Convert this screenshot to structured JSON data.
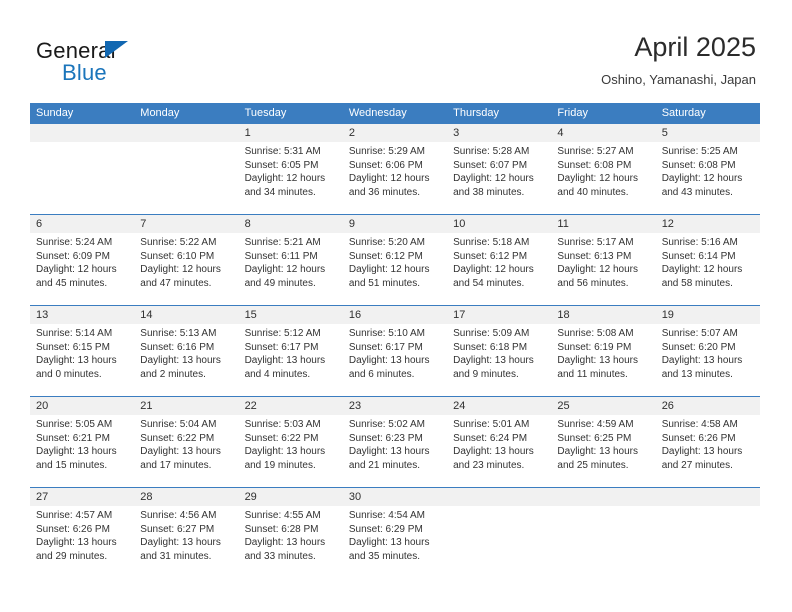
{
  "logo": {
    "word1": "General",
    "word2": "Blue",
    "triangle_color": "#1167b1",
    "blue_color": "#1b75bb"
  },
  "header": {
    "title": "April 2025",
    "subtitle": "Oshino, Yamanashi, Japan",
    "accent_color": "#3b7dc0",
    "band_color": "#f1f1f1"
  },
  "weekdays": [
    "Sunday",
    "Monday",
    "Tuesday",
    "Wednesday",
    "Thursday",
    "Friday",
    "Saturday"
  ],
  "weeks": [
    [
      {
        "day": "",
        "sunrise": "",
        "sunset": "",
        "daylight1": "",
        "daylight2": ""
      },
      {
        "day": "",
        "sunrise": "",
        "sunset": "",
        "daylight1": "",
        "daylight2": ""
      },
      {
        "day": "1",
        "sunrise": "Sunrise: 5:31 AM",
        "sunset": "Sunset: 6:05 PM",
        "daylight1": "Daylight: 12 hours",
        "daylight2": "and 34 minutes."
      },
      {
        "day": "2",
        "sunrise": "Sunrise: 5:29 AM",
        "sunset": "Sunset: 6:06 PM",
        "daylight1": "Daylight: 12 hours",
        "daylight2": "and 36 minutes."
      },
      {
        "day": "3",
        "sunrise": "Sunrise: 5:28 AM",
        "sunset": "Sunset: 6:07 PM",
        "daylight1": "Daylight: 12 hours",
        "daylight2": "and 38 minutes."
      },
      {
        "day": "4",
        "sunrise": "Sunrise: 5:27 AM",
        "sunset": "Sunset: 6:08 PM",
        "daylight1": "Daylight: 12 hours",
        "daylight2": "and 40 minutes."
      },
      {
        "day": "5",
        "sunrise": "Sunrise: 5:25 AM",
        "sunset": "Sunset: 6:08 PM",
        "daylight1": "Daylight: 12 hours",
        "daylight2": "and 43 minutes."
      }
    ],
    [
      {
        "day": "6",
        "sunrise": "Sunrise: 5:24 AM",
        "sunset": "Sunset: 6:09 PM",
        "daylight1": "Daylight: 12 hours",
        "daylight2": "and 45 minutes."
      },
      {
        "day": "7",
        "sunrise": "Sunrise: 5:22 AM",
        "sunset": "Sunset: 6:10 PM",
        "daylight1": "Daylight: 12 hours",
        "daylight2": "and 47 minutes."
      },
      {
        "day": "8",
        "sunrise": "Sunrise: 5:21 AM",
        "sunset": "Sunset: 6:11 PM",
        "daylight1": "Daylight: 12 hours",
        "daylight2": "and 49 minutes."
      },
      {
        "day": "9",
        "sunrise": "Sunrise: 5:20 AM",
        "sunset": "Sunset: 6:12 PM",
        "daylight1": "Daylight: 12 hours",
        "daylight2": "and 51 minutes."
      },
      {
        "day": "10",
        "sunrise": "Sunrise: 5:18 AM",
        "sunset": "Sunset: 6:12 PM",
        "daylight1": "Daylight: 12 hours",
        "daylight2": "and 54 minutes."
      },
      {
        "day": "11",
        "sunrise": "Sunrise: 5:17 AM",
        "sunset": "Sunset: 6:13 PM",
        "daylight1": "Daylight: 12 hours",
        "daylight2": "and 56 minutes."
      },
      {
        "day": "12",
        "sunrise": "Sunrise: 5:16 AM",
        "sunset": "Sunset: 6:14 PM",
        "daylight1": "Daylight: 12 hours",
        "daylight2": "and 58 minutes."
      }
    ],
    [
      {
        "day": "13",
        "sunrise": "Sunrise: 5:14 AM",
        "sunset": "Sunset: 6:15 PM",
        "daylight1": "Daylight: 13 hours",
        "daylight2": "and 0 minutes."
      },
      {
        "day": "14",
        "sunrise": "Sunrise: 5:13 AM",
        "sunset": "Sunset: 6:16 PM",
        "daylight1": "Daylight: 13 hours",
        "daylight2": "and 2 minutes."
      },
      {
        "day": "15",
        "sunrise": "Sunrise: 5:12 AM",
        "sunset": "Sunset: 6:17 PM",
        "daylight1": "Daylight: 13 hours",
        "daylight2": "and 4 minutes."
      },
      {
        "day": "16",
        "sunrise": "Sunrise: 5:10 AM",
        "sunset": "Sunset: 6:17 PM",
        "daylight1": "Daylight: 13 hours",
        "daylight2": "and 6 minutes."
      },
      {
        "day": "17",
        "sunrise": "Sunrise: 5:09 AM",
        "sunset": "Sunset: 6:18 PM",
        "daylight1": "Daylight: 13 hours",
        "daylight2": "and 9 minutes."
      },
      {
        "day": "18",
        "sunrise": "Sunrise: 5:08 AM",
        "sunset": "Sunset: 6:19 PM",
        "daylight1": "Daylight: 13 hours",
        "daylight2": "and 11 minutes."
      },
      {
        "day": "19",
        "sunrise": "Sunrise: 5:07 AM",
        "sunset": "Sunset: 6:20 PM",
        "daylight1": "Daylight: 13 hours",
        "daylight2": "and 13 minutes."
      }
    ],
    [
      {
        "day": "20",
        "sunrise": "Sunrise: 5:05 AM",
        "sunset": "Sunset: 6:21 PM",
        "daylight1": "Daylight: 13 hours",
        "daylight2": "and 15 minutes."
      },
      {
        "day": "21",
        "sunrise": "Sunrise: 5:04 AM",
        "sunset": "Sunset: 6:22 PM",
        "daylight1": "Daylight: 13 hours",
        "daylight2": "and 17 minutes."
      },
      {
        "day": "22",
        "sunrise": "Sunrise: 5:03 AM",
        "sunset": "Sunset: 6:22 PM",
        "daylight1": "Daylight: 13 hours",
        "daylight2": "and 19 minutes."
      },
      {
        "day": "23",
        "sunrise": "Sunrise: 5:02 AM",
        "sunset": "Sunset: 6:23 PM",
        "daylight1": "Daylight: 13 hours",
        "daylight2": "and 21 minutes."
      },
      {
        "day": "24",
        "sunrise": "Sunrise: 5:01 AM",
        "sunset": "Sunset: 6:24 PM",
        "daylight1": "Daylight: 13 hours",
        "daylight2": "and 23 minutes."
      },
      {
        "day": "25",
        "sunrise": "Sunrise: 4:59 AM",
        "sunset": "Sunset: 6:25 PM",
        "daylight1": "Daylight: 13 hours",
        "daylight2": "and 25 minutes."
      },
      {
        "day": "26",
        "sunrise": "Sunrise: 4:58 AM",
        "sunset": "Sunset: 6:26 PM",
        "daylight1": "Daylight: 13 hours",
        "daylight2": "and 27 minutes."
      }
    ],
    [
      {
        "day": "27",
        "sunrise": "Sunrise: 4:57 AM",
        "sunset": "Sunset: 6:26 PM",
        "daylight1": "Daylight: 13 hours",
        "daylight2": "and 29 minutes."
      },
      {
        "day": "28",
        "sunrise": "Sunrise: 4:56 AM",
        "sunset": "Sunset: 6:27 PM",
        "daylight1": "Daylight: 13 hours",
        "daylight2": "and 31 minutes."
      },
      {
        "day": "29",
        "sunrise": "Sunrise: 4:55 AM",
        "sunset": "Sunset: 6:28 PM",
        "daylight1": "Daylight: 13 hours",
        "daylight2": "and 33 minutes."
      },
      {
        "day": "30",
        "sunrise": "Sunrise: 4:54 AM",
        "sunset": "Sunset: 6:29 PM",
        "daylight1": "Daylight: 13 hours",
        "daylight2": "and 35 minutes."
      },
      {
        "day": "",
        "sunrise": "",
        "sunset": "",
        "daylight1": "",
        "daylight2": ""
      },
      {
        "day": "",
        "sunrise": "",
        "sunset": "",
        "daylight1": "",
        "daylight2": ""
      },
      {
        "day": "",
        "sunrise": "",
        "sunset": "",
        "daylight1": "",
        "daylight2": ""
      }
    ]
  ]
}
